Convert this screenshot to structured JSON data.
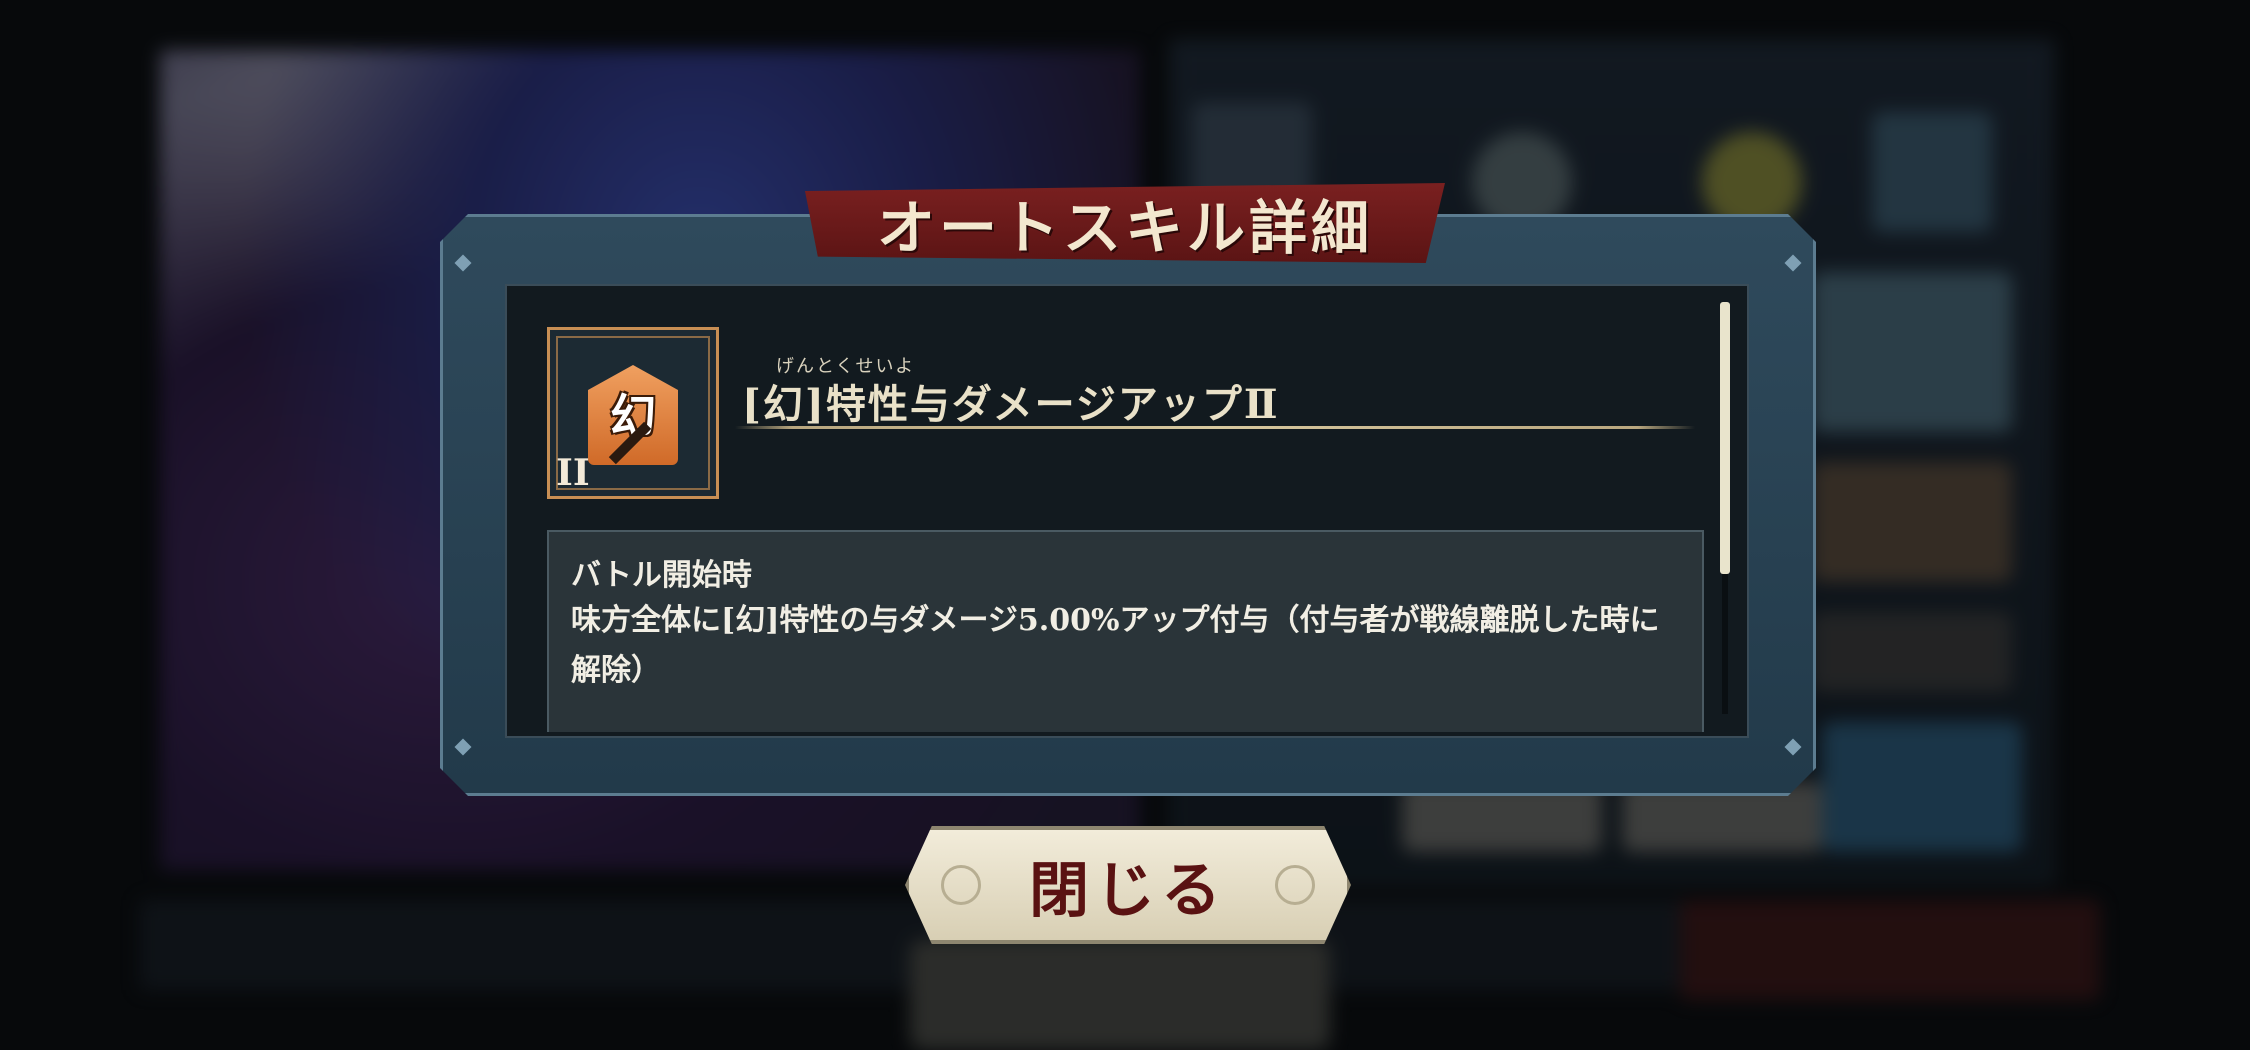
{
  "dialog": {
    "title": "オートスキル詳細",
    "skill": {
      "icon_glyph": "幻",
      "icon_level": "II",
      "ruby": "げんとくせいよ",
      "name": "[幻]特性与ダメージアップⅡ"
    },
    "description": {
      "trigger": "バトル開始時",
      "effect": "味方全体に[幻]特性の与ダメージ5.00%アップ付与（付与者が戦線離脱した時に解除）"
    },
    "close_label": "閉じる"
  },
  "colors": {
    "banner": "#7a2020",
    "frame": "#2f4a5c",
    "close_text": "#5a1212",
    "icon_orange": "#e0803a"
  }
}
